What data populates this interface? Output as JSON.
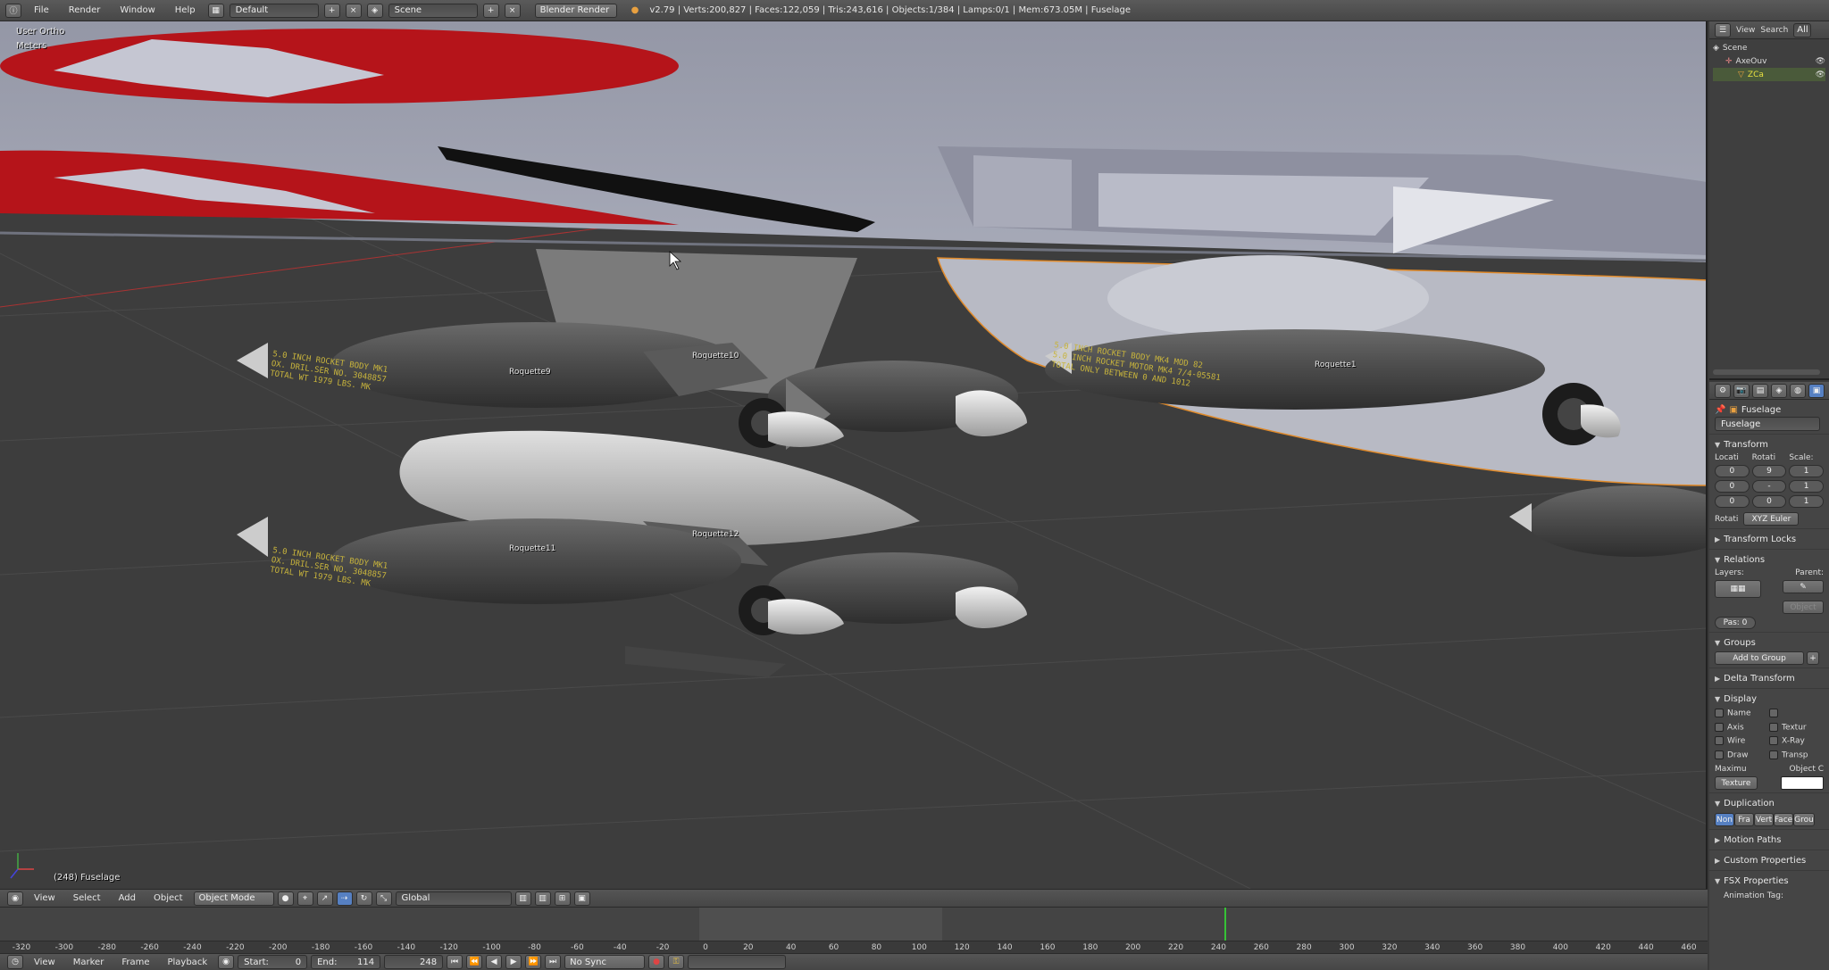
{
  "app": {
    "title": "Blender"
  },
  "topbar": {
    "menus": [
      "File",
      "Render",
      "Window",
      "Help"
    ],
    "layout": "Default",
    "scene": "Scene",
    "engine": "Blender Render",
    "stats": "v2.79 | Verts:200,827 | Faces:122,059 | Tris:243,616 | Objects:1/384 | Lamps:0/1 | Mem:673.05M | Fuselage"
  },
  "viewport": {
    "view_name": "User Ortho",
    "units": "Meters",
    "object_info": "(248) Fuselage",
    "labels": {
      "rocket1": "Roquette9",
      "rocket2": "Roquette10",
      "rocket3": "Roquette11",
      "rocket4": "Roquette12",
      "rocket5": "Roquette1"
    },
    "stencil_lines": [
      "5.0 INCH ROCKET BODY MK1",
      "OX. DRIL.SER NO. 3048857",
      "TOTAL WT 1979 LBS. MK"
    ],
    "stencil_lines_b": [
      "5.0 INCH ROCKET BODY MK4 MOD 82",
      "5.0 INCH ROCKET MOTOR MK4 7/4-05581",
      "TOTAL ONLY BETWEEN 0 AND 1012"
    ]
  },
  "vpheader": {
    "menus": [
      "View",
      "Select",
      "Add",
      "Object"
    ],
    "mode": "Object Mode",
    "orientation": "Global"
  },
  "timeline": {
    "ticks": [
      "-320",
      "-300",
      "-280",
      "-260",
      "-240",
      "-220",
      "-200",
      "-180",
      "-160",
      "-140",
      "-120",
      "-100",
      "-80",
      "-60",
      "-40",
      "-20",
      "0",
      "20",
      "40",
      "60",
      "80",
      "100",
      "120",
      "140",
      "160",
      "180",
      "200",
      "220",
      "240",
      "260",
      "280",
      "300",
      "320",
      "340",
      "360",
      "380",
      "400",
      "420",
      "440",
      "460"
    ],
    "current_frame": 248
  },
  "tlheader": {
    "menus": [
      "View",
      "Marker",
      "Frame",
      "Playback"
    ],
    "start_label": "Start:",
    "start": "0",
    "end_label": "End:",
    "end": "114",
    "frame": "248",
    "sync": "No Sync"
  },
  "outliner": {
    "menus": [
      "View",
      "Search"
    ],
    "all_label": "All",
    "rows": [
      "Scene",
      "AxeOuv",
      "ZCa"
    ]
  },
  "props": {
    "breadcrumb": "Fuselage",
    "object_name": "Fuselage",
    "transform": {
      "title": "Transform",
      "headers": [
        "Locati",
        "Rotati",
        "Scale:"
      ],
      "loc": [
        "0",
        "0",
        "0"
      ],
      "rot": [
        "9",
        "-",
        "0"
      ],
      "scale": [
        "1",
        "1",
        "1"
      ],
      "rot_mode_label": "Rotati",
      "rot_mode": "XYZ Euler"
    },
    "transform_locks": "Transform Locks",
    "relations": {
      "title": "Relations",
      "layers": "Layers:",
      "parent": "Parent:",
      "parent_type": "Object",
      "pass": "Pas: 0"
    },
    "groups": {
      "title": "Groups",
      "add": "Add to Group"
    },
    "delta": "Delta Transform",
    "display": {
      "title": "Display",
      "left": [
        "Name",
        "Axis",
        "Wire",
        "Draw"
      ],
      "right": [
        "Textur",
        "X-Ray",
        "Transp"
      ],
      "max_label": "Maximu",
      "color_label": "Object C",
      "max_value": "Texture"
    },
    "duplication": {
      "title": "Duplication",
      "options": [
        "Non",
        "Fra",
        "Vert",
        "Face",
        "Grou"
      ]
    },
    "collapsed": [
      "Motion Paths",
      "Custom Properties",
      "FSX Properties"
    ],
    "anim_tag": "Animation Tag:"
  },
  "colors": {
    "accent": "#5680c2",
    "timeline_marker": "#36c236",
    "red": "#b5141a"
  }
}
